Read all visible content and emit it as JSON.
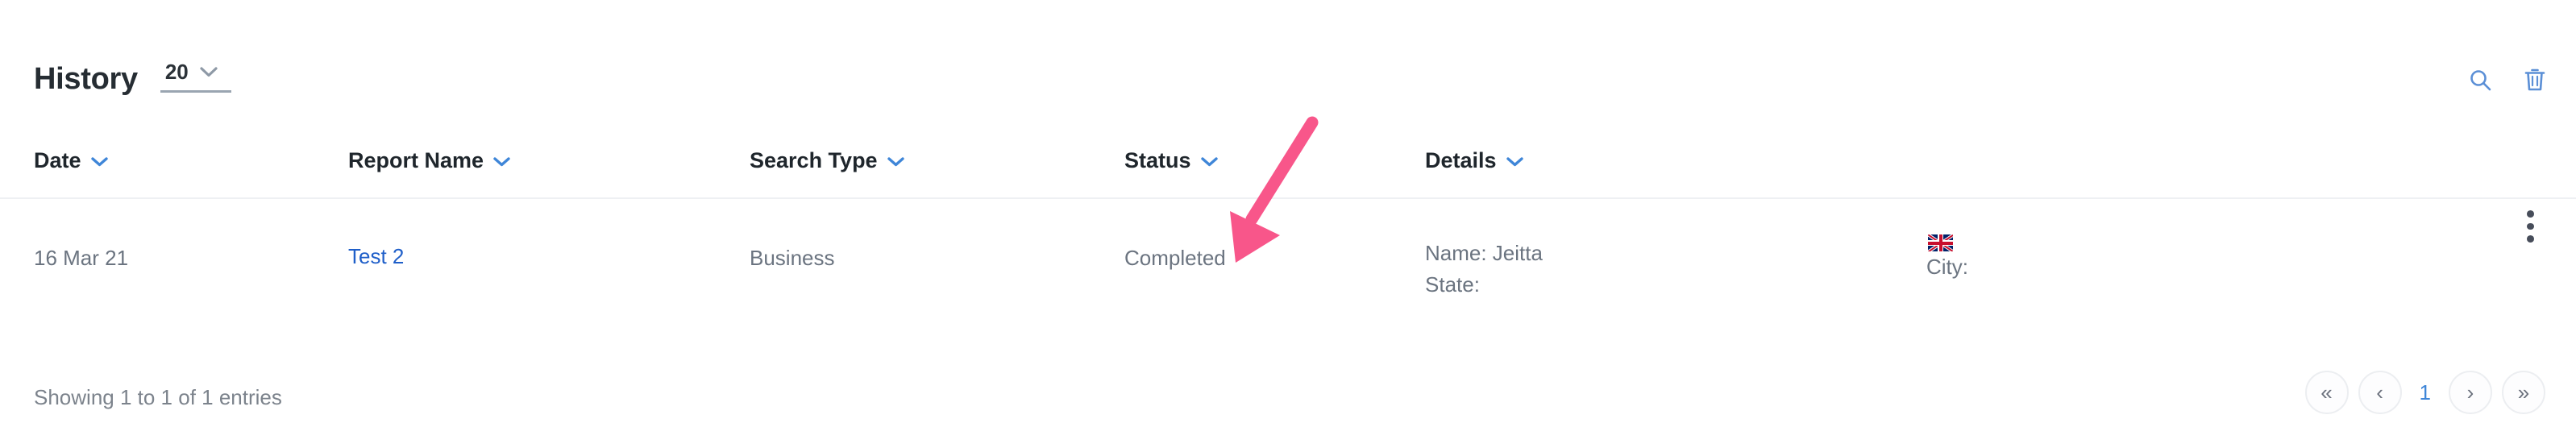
{
  "header": {
    "title": "History",
    "page_size_value": "20",
    "page_size_icon": "chevron-down-icon",
    "search_icon": "search-icon",
    "delete_icon": "trash-icon"
  },
  "table": {
    "columns": [
      {
        "label": "Date",
        "sort_icon": "chevron-down-icon"
      },
      {
        "label": "Report Name",
        "sort_icon": "chevron-down-icon"
      },
      {
        "label": "Search Type",
        "sort_icon": "chevron-down-icon"
      },
      {
        "label": "Status",
        "sort_icon": "chevron-down-icon"
      },
      {
        "label": "Details",
        "sort_icon": "chevron-down-icon"
      }
    ],
    "rows": [
      {
        "date": "16 Mar 21",
        "report_name": "Test 2",
        "search_type": "Business",
        "status": "Completed",
        "details_name": "Name: Jeitta",
        "details_state": "State:",
        "details_city": "City:",
        "flag": "uk-flag-icon",
        "row_menu_icon": "kebab-menu-icon"
      }
    ]
  },
  "footer": {
    "info": "Showing 1 to 1 of 1 entries",
    "pagination": {
      "first_label": "«",
      "prev_label": "‹",
      "current_page": "1",
      "next_label": "›",
      "last_label": "»"
    }
  },
  "annotation": {
    "arrow": "pink-annotation-arrow",
    "color": "#f8568a",
    "points_at": "Completed"
  },
  "colors": {
    "link_blue": "#1f5fc9",
    "icon_blue": "#5b8fd6",
    "sort_blue": "#3f86d8",
    "text_gray": "#6b7480",
    "title_dark": "#262d33",
    "divider": "#eef0f3"
  }
}
